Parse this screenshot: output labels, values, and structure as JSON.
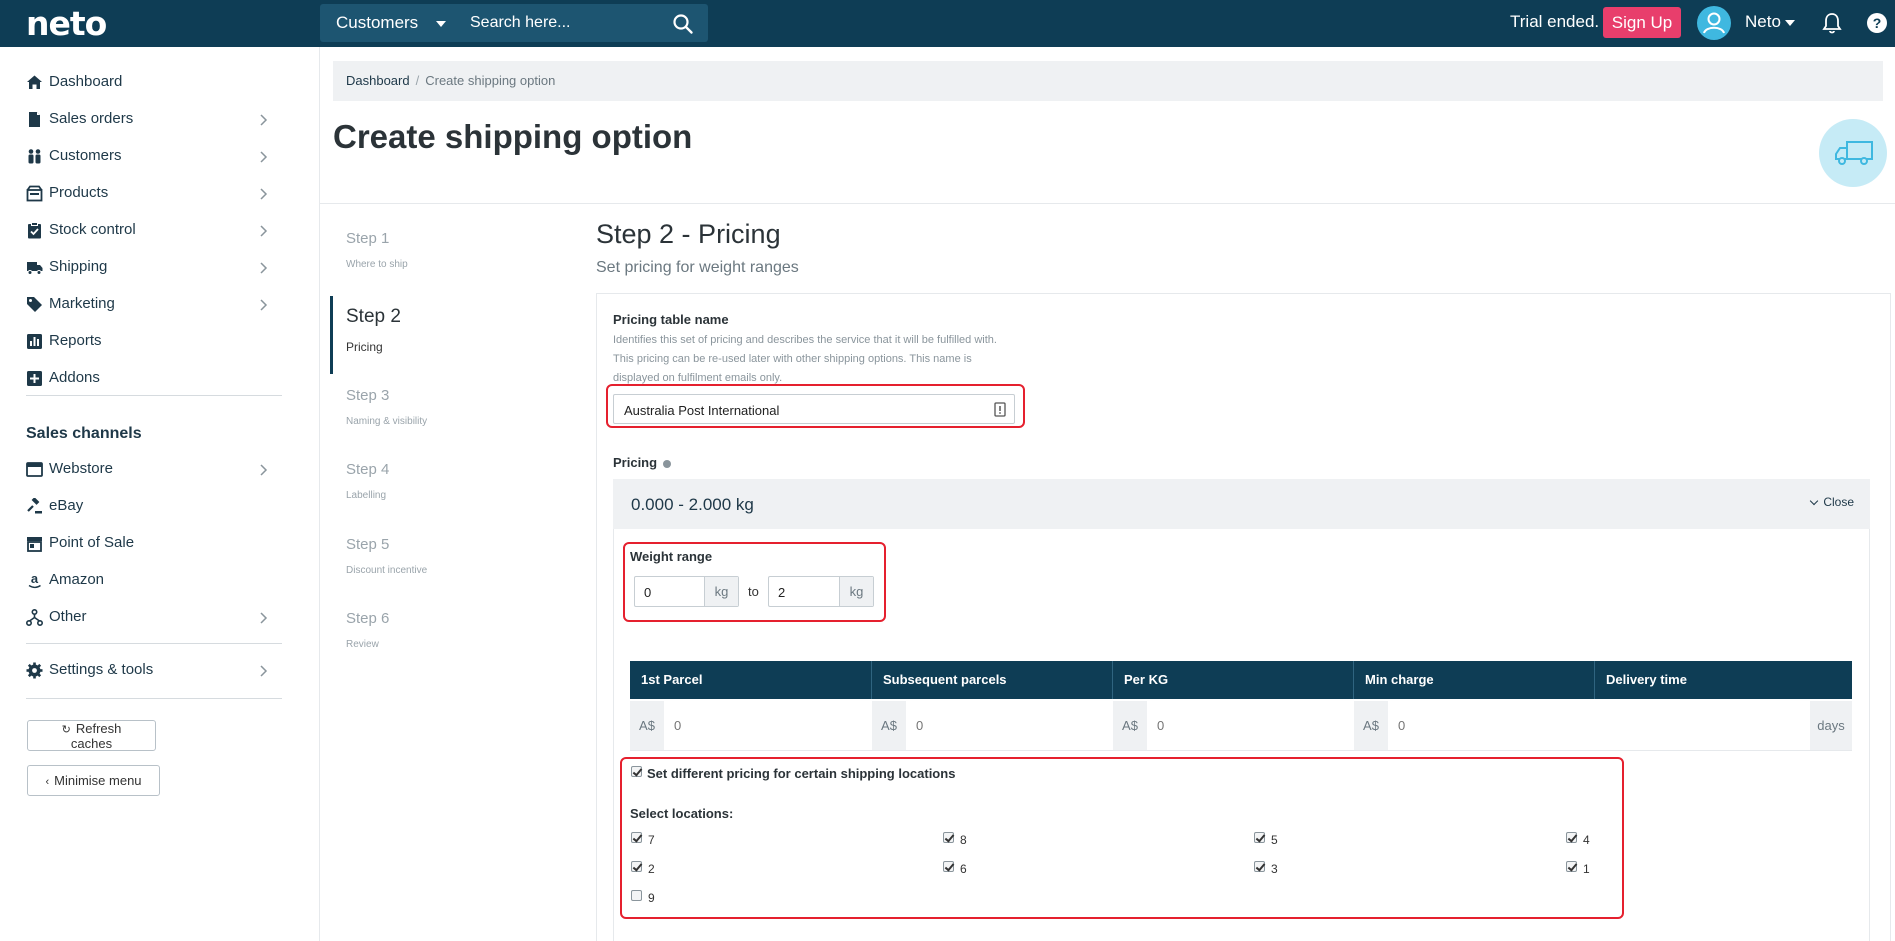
{
  "header": {
    "logo": "neto",
    "search_scope": "Customers",
    "search_placeholder": "Search here...",
    "trial_text": "Trial ended.",
    "signup_label": "Sign Up",
    "user_name": "Neto"
  },
  "sidebar": {
    "items": [
      {
        "label": "Dashboard",
        "icon": "home-icon",
        "chevron": false
      },
      {
        "label": "Sales orders",
        "icon": "document-icon",
        "chevron": true
      },
      {
        "label": "Customers",
        "icon": "people-icon",
        "chevron": true
      },
      {
        "label": "Products",
        "icon": "product-icon",
        "chevron": true
      },
      {
        "label": "Stock control",
        "icon": "clipboard-icon",
        "chevron": true
      },
      {
        "label": "Shipping",
        "icon": "truck-icon",
        "chevron": true
      },
      {
        "label": "Marketing",
        "icon": "tag-icon",
        "chevron": true
      },
      {
        "label": "Reports",
        "icon": "chart-icon",
        "chevron": false
      },
      {
        "label": "Addons",
        "icon": "plus-icon",
        "chevron": false
      }
    ],
    "channels_heading": "Sales channels",
    "channels": [
      {
        "label": "Webstore",
        "icon": "browser-icon",
        "chevron": true
      },
      {
        "label": "eBay",
        "icon": "gavel-icon",
        "chevron": false
      },
      {
        "label": "Point of Sale",
        "icon": "store-icon",
        "chevron": false
      },
      {
        "label": "Amazon",
        "icon": "amazon-icon",
        "chevron": false
      },
      {
        "label": "Other",
        "icon": "nodes-icon",
        "chevron": true
      }
    ],
    "settings_label": "Settings & tools",
    "refresh_label": "Refresh caches",
    "minimise_label": "Minimise menu"
  },
  "breadcrumb": {
    "home": "Dashboard",
    "separator": "/",
    "current": "Create shipping option"
  },
  "page": {
    "title": "Create shipping option"
  },
  "steps": [
    {
      "title": "Step 1",
      "sub": "Where to ship",
      "active": false
    },
    {
      "title": "Step 2",
      "sub": "Pricing",
      "active": true
    },
    {
      "title": "Step 3",
      "sub": "Naming & visibility",
      "active": false
    },
    {
      "title": "Step 4",
      "sub": "Labelling",
      "active": false
    },
    {
      "title": "Step 5",
      "sub": "Discount incentive",
      "active": false
    },
    {
      "title": "Step 6",
      "sub": "Review",
      "active": false
    }
  ],
  "form": {
    "heading": "Step 2 - Pricing",
    "description": "Set pricing for weight ranges",
    "table_name_label": "Pricing table name",
    "table_name_help": "Identifies this set of pricing and describes the service that it will be fulfilled with. This pricing can be re-used later with other shipping options. This name is displayed on fulfilment emails only.",
    "table_name_value": "Australia Post International",
    "pricing_label": "Pricing",
    "range_title": "0.000 - 2.000 kg",
    "close_label": "Close",
    "weight_range_label": "Weight range",
    "weight_from": "0",
    "weight_to": "2",
    "weight_unit": "kg",
    "to_label": "to",
    "columns": [
      "1st Parcel",
      "Subsequent parcels",
      "Per KG",
      "Min charge",
      "Delivery time"
    ],
    "currency": "A$",
    "values": [
      "0",
      "0",
      "0",
      "0"
    ],
    "days_label": "days",
    "diff_pricing_label": "Set different pricing for certain shipping locations",
    "diff_pricing_checked": true,
    "select_locations_label": "Select locations:",
    "locations": [
      {
        "label": "7",
        "checked": true
      },
      {
        "label": "8",
        "checked": true
      },
      {
        "label": "5",
        "checked": true
      },
      {
        "label": "4",
        "checked": true
      },
      {
        "label": "2",
        "checked": true
      },
      {
        "label": "6",
        "checked": true
      },
      {
        "label": "3",
        "checked": true
      },
      {
        "label": "1",
        "checked": true
      },
      {
        "label": "9",
        "checked": false
      }
    ]
  },
  "colors": {
    "topbar": "#0e3d55",
    "accent_pink": "#e83e6c",
    "avatar": "#3fb8e0",
    "highlight_red": "#e5202e"
  }
}
